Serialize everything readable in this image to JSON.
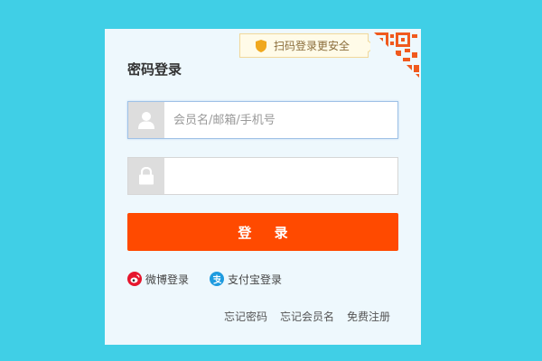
{
  "qr_tip": {
    "label": "扫码登录更安全"
  },
  "form": {
    "title": "密码登录",
    "username_placeholder": "会员名/邮箱/手机号",
    "username_value": "",
    "password_value": "",
    "submit_label": "登 录"
  },
  "social": {
    "weibo_label": "微博登录",
    "alipay_label": "支付宝登录"
  },
  "links": {
    "forgot_password": "忘记密码",
    "forgot_username": "忘记会员名",
    "register": "免费注册"
  },
  "colors": {
    "page_bg": "#40cfe6",
    "panel_bg": "#eef8fd",
    "primary_button": "#ff4a00",
    "qr_accent": "#f05a1e"
  }
}
